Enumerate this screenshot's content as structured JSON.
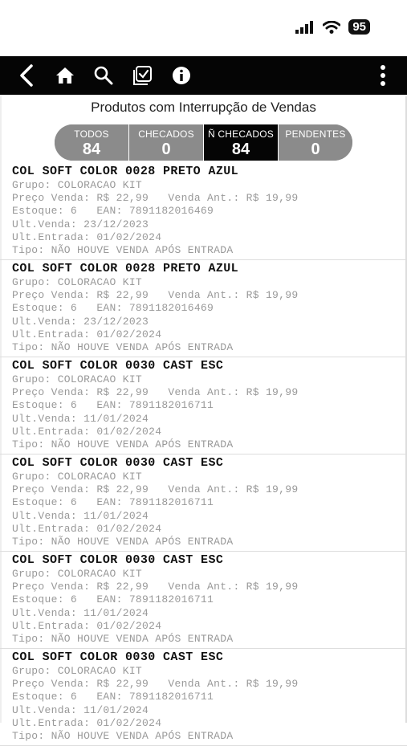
{
  "status": {
    "battery": "95"
  },
  "toolbar": {
    "back": "back-icon",
    "home": "home-icon",
    "search": "search-icon",
    "checklist": "checklist-icon",
    "info": "info-icon",
    "more": "more-vertical-icon"
  },
  "title": "Produtos com Interrupção de Vendas",
  "tabs": [
    {
      "label": "TODOS",
      "count": "84"
    },
    {
      "label": "CHECADOS",
      "count": "0"
    },
    {
      "label": "Ñ CHECADOS",
      "count": "84"
    },
    {
      "label": "PENDENTES",
      "count": "0"
    }
  ],
  "items": [
    {
      "name": "COL SOFT COLOR 0028 PRETO AZUL",
      "grupo": "Grupo: COLORACAO KIT",
      "preco": "Preço Venda: R$ 22,99   Venda Ant.: R$ 19,99",
      "estoque": "Estoque: 6   EAN: 7891182016469",
      "ult_venda": "Ult.Venda: 23/12/2023",
      "ult_entrada": "Ult.Entrada: 01/02/2024",
      "tipo": "Tipo: NÃO HOUVE VENDA APÓS ENTRADA"
    },
    {
      "name": "COL SOFT COLOR 0028 PRETO AZUL",
      "grupo": "Grupo: COLORACAO KIT",
      "preco": "Preço Venda: R$ 22,99   Venda Ant.: R$ 19,99",
      "estoque": "Estoque: 6   EAN: 7891182016469",
      "ult_venda": "Ult.Venda: 23/12/2023",
      "ult_entrada": "Ult.Entrada: 01/02/2024",
      "tipo": "Tipo: NÃO HOUVE VENDA APÓS ENTRADA"
    },
    {
      "name": "COL SOFT COLOR 0030 CAST ESC",
      "grupo": "Grupo: COLORACAO KIT",
      "preco": "Preço Venda: R$ 22,99   Venda Ant.: R$ 19,99",
      "estoque": "Estoque: 6   EAN: 7891182016711",
      "ult_venda": "Ult.Venda: 11/01/2024",
      "ult_entrada": "Ult.Entrada: 01/02/2024",
      "tipo": "Tipo: NÃO HOUVE VENDA APÓS ENTRADA"
    },
    {
      "name": "COL SOFT COLOR 0030 CAST ESC",
      "grupo": "Grupo: COLORACAO KIT",
      "preco": "Preço Venda: R$ 22,99   Venda Ant.: R$ 19,99",
      "estoque": "Estoque: 6   EAN: 7891182016711",
      "ult_venda": "Ult.Venda: 11/01/2024",
      "ult_entrada": "Ult.Entrada: 01/02/2024",
      "tipo": "Tipo: NÃO HOUVE VENDA APÓS ENTRADA"
    },
    {
      "name": "COL SOFT COLOR 0030 CAST ESC",
      "grupo": "Grupo: COLORACAO KIT",
      "preco": "Preço Venda: R$ 22,99   Venda Ant.: R$ 19,99",
      "estoque": "Estoque: 6   EAN: 7891182016711",
      "ult_venda": "Ult.Venda: 11/01/2024",
      "ult_entrada": "Ult.Entrada: 01/02/2024",
      "tipo": "Tipo: NÃO HOUVE VENDA APÓS ENTRADA"
    },
    {
      "name": "COL SOFT COLOR 0030 CAST ESC",
      "grupo": "Grupo: COLORACAO KIT",
      "preco": "Preço Venda: R$ 22,99   Venda Ant.: R$ 19,99",
      "estoque": "Estoque: 6   EAN: 7891182016711",
      "ult_venda": "Ult.Venda: 11/01/2024",
      "ult_entrada": "Ult.Entrada: 01/02/2024",
      "tipo": "Tipo: NÃO HOUVE VENDA APÓS ENTRADA"
    }
  ]
}
